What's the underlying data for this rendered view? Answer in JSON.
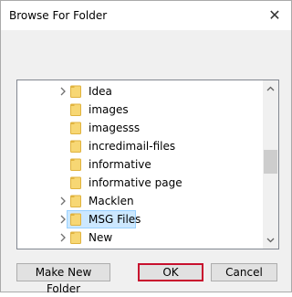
{
  "window": {
    "title": "Browse For Folder",
    "close_label": "X"
  },
  "tree": {
    "items": [
      {
        "label": "Idea",
        "has_children": true,
        "selected": false
      },
      {
        "label": "images",
        "has_children": false,
        "selected": false
      },
      {
        "label": "imagesss",
        "has_children": false,
        "selected": false
      },
      {
        "label": "incredimail-files",
        "has_children": false,
        "selected": false
      },
      {
        "label": "informative",
        "has_children": false,
        "selected": false
      },
      {
        "label": "informative page",
        "has_children": false,
        "selected": false
      },
      {
        "label": "Macklen",
        "has_children": true,
        "selected": false
      },
      {
        "label": "MSG Files",
        "has_children": true,
        "selected": true
      },
      {
        "label": "New",
        "has_children": true,
        "selected": false
      }
    ]
  },
  "buttons": {
    "new_folder": "Make New Folder",
    "ok": "OK",
    "cancel": "Cancel"
  },
  "colors": {
    "accent_focus": "#c8102e",
    "selection_bg": "#cce8ff",
    "folder": "#f7d774"
  }
}
